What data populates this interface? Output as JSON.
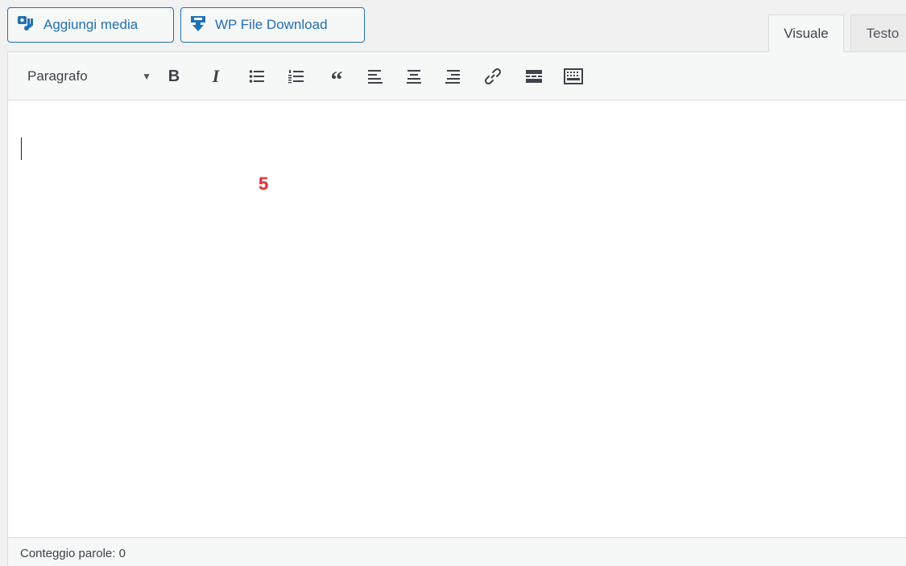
{
  "media_buttons": {
    "add_media": "Aggiungi media",
    "wp_file_download": "WP File Download"
  },
  "tabs": {
    "visual": "Visuale",
    "text": "Testo"
  },
  "toolbar": {
    "format_select": "Paragrafo",
    "bold": "B",
    "italic": "I",
    "blockquote": "“"
  },
  "content": {
    "step_marker": "5"
  },
  "status": {
    "word_count": "Conteggio parole: 0"
  },
  "colors": {
    "accent": "#2271b1",
    "marker": "#d63638"
  }
}
